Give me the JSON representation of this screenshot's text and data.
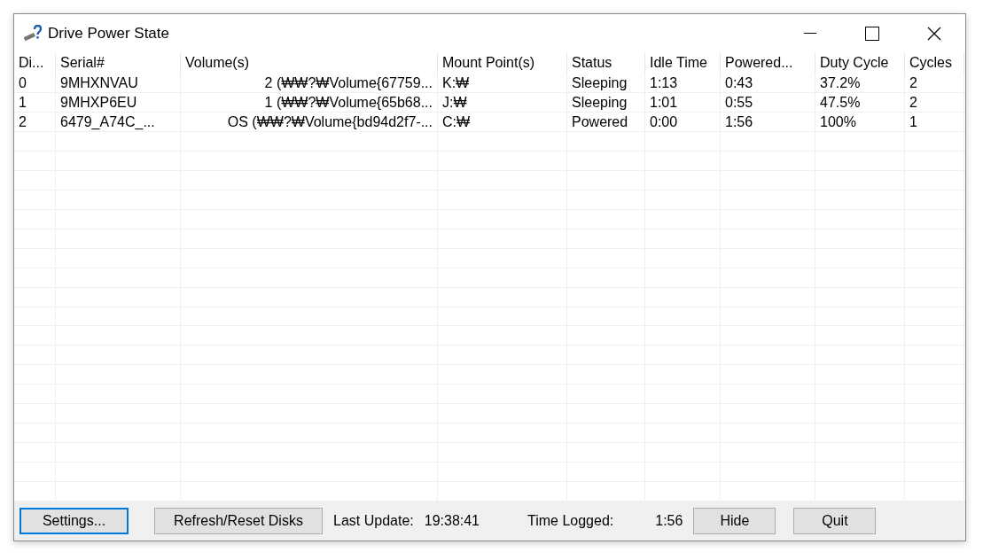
{
  "window": {
    "title": "Drive Power State"
  },
  "table": {
    "columns": [
      {
        "label": "Di..."
      },
      {
        "label": "Serial#"
      },
      {
        "label": "Volume(s)"
      },
      {
        "label": "Mount Point(s)"
      },
      {
        "label": "Status"
      },
      {
        "label": "Idle Time"
      },
      {
        "label": "Powered..."
      },
      {
        "label": "Duty Cycle"
      },
      {
        "label": "Cycles"
      }
    ],
    "rows": [
      [
        "0",
        "9MHXNVAU",
        "2 (₩₩?₩Volume{67759...",
        "K:₩",
        "Sleeping",
        "1:13",
        "0:43",
        "37.2%",
        "2"
      ],
      [
        "1",
        "9MHXP6EU",
        "1 (₩₩?₩Volume{65b68...",
        "J:₩",
        "Sleeping",
        "1:01",
        "0:55",
        "47.5%",
        "2"
      ],
      [
        "2",
        "6479_A74C_...",
        "OS (₩₩?₩Volume{bd94d2f7-...",
        "C:₩",
        "Powered",
        "0:00",
        "1:56",
        "100%",
        "1"
      ]
    ]
  },
  "footer": {
    "settings_button": "Settings...",
    "refresh_button": "Refresh/Reset Disks",
    "last_update_label": "Last Update:",
    "last_update_value": "19:38:41",
    "time_logged_label": "Time Logged:",
    "time_logged_value": "1:56",
    "hide_button": "Hide",
    "quit_button": "Quit"
  }
}
